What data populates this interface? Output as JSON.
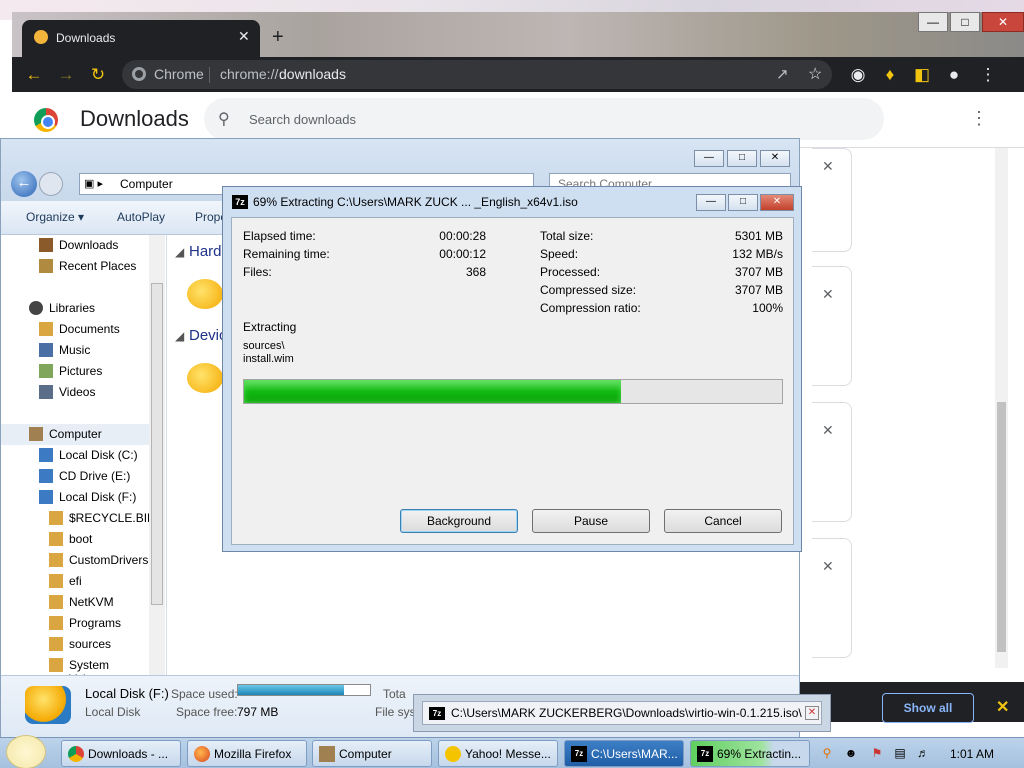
{
  "chrome": {
    "tab_title": "Downloads",
    "tab_close": "✕",
    "new_tab": "+",
    "omnibox_label": "Chrome",
    "url_prefix": "chrome://",
    "url_path": "downloads",
    "page_title": "Downloads",
    "search_placeholder": "Search downloads",
    "show_all": "Show all",
    "card_close": "✕"
  },
  "explorer": {
    "address": "Computer",
    "search_placeholder": "Search Computer",
    "commands": [
      "Organize ▾",
      "AutoPlay",
      "Prope"
    ],
    "nav": [
      {
        "label": "Downloads",
        "icon": "downloads-folder-icon"
      },
      {
        "label": "Recent Places",
        "icon": "recent-places-icon"
      },
      {
        "label": "Libraries",
        "icon": "libraries-icon"
      },
      {
        "label": "Documents",
        "icon": "documents-icon"
      },
      {
        "label": "Music",
        "icon": "music-icon"
      },
      {
        "label": "Pictures",
        "icon": "pictures-icon"
      },
      {
        "label": "Videos",
        "icon": "videos-icon"
      },
      {
        "label": "Computer",
        "icon": "computer-icon"
      },
      {
        "label": "Local Disk (C:)",
        "icon": "drive-icon"
      },
      {
        "label": "CD Drive (E:)",
        "icon": "cd-drive-icon"
      },
      {
        "label": "Local Disk (F:)",
        "icon": "drive-icon"
      },
      {
        "label": "$RECYCLE.BIN",
        "icon": "folder-icon"
      },
      {
        "label": "boot",
        "icon": "folder-icon"
      },
      {
        "label": "CustomDrivers",
        "icon": "folder-icon"
      },
      {
        "label": "efi",
        "icon": "folder-icon"
      },
      {
        "label": "NetKVM",
        "icon": "folder-icon"
      },
      {
        "label": "Programs",
        "icon": "folder-icon"
      },
      {
        "label": "sources",
        "icon": "folder-icon"
      },
      {
        "label": "System Volume",
        "icon": "folder-icon"
      }
    ],
    "section_hard": "Hard",
    "section_devices": "Devic",
    "details": {
      "name": "Local Disk (F:)",
      "type": "Local Disk",
      "space_used_label": "Space used:",
      "space_free_label": "Space free:",
      "space_free_value": "797 MB",
      "total_label": "Tota",
      "fs_label": "File sys",
      "used_fraction": 0.8
    }
  },
  "zip": {
    "title": "69% Extracting C:\\Users\\MARK ZUCK ... _English_x64v1.iso",
    "left": [
      {
        "label": "Elapsed time:",
        "value": "00:00:28"
      },
      {
        "label": "Remaining time:",
        "value": "00:00:12"
      },
      {
        "label": "Files:",
        "value": "368"
      }
    ],
    "right": [
      {
        "label": "Total size:",
        "value": "5301 MB"
      },
      {
        "label": "Speed:",
        "value": "132 MB/s"
      },
      {
        "label": "Processed:",
        "value": "3707 MB"
      },
      {
        "label": "Compressed size:",
        "value": "3707 MB"
      },
      {
        "label": "Compression ratio:",
        "value": "100%"
      }
    ],
    "action": "Extracting",
    "path_line1": "sources\\",
    "path_line2": "install.wim",
    "progress": 0.7,
    "buttons": {
      "background": "Background",
      "pause": "Pause",
      "cancel": "Cancel"
    }
  },
  "notification": {
    "text": "C:\\Users\\MARK ZUCKERBERG\\Downloads\\virtio-win-0.1.215.iso\\"
  },
  "taskbar": {
    "items": [
      {
        "label": "Downloads - ...",
        "icon": "chrome-icon"
      },
      {
        "label": "Mozilla Firefox",
        "icon": "firefox-icon"
      },
      {
        "label": "Computer",
        "icon": "computer-icon"
      },
      {
        "label": "Yahoo! Messe...",
        "icon": "yahoo-messenger-icon"
      },
      {
        "label": "C:\\Users\\MAR...",
        "icon": "7zip-icon"
      },
      {
        "label": "69% Extractin...",
        "icon": "7zip-icon"
      }
    ],
    "clock": "1:01 AM"
  },
  "colors": {
    "chrome_dark": "#202124",
    "accent_yellow": "#f1c40f",
    "progress_green": "#11b911",
    "win_close_red": "#c9463d"
  }
}
